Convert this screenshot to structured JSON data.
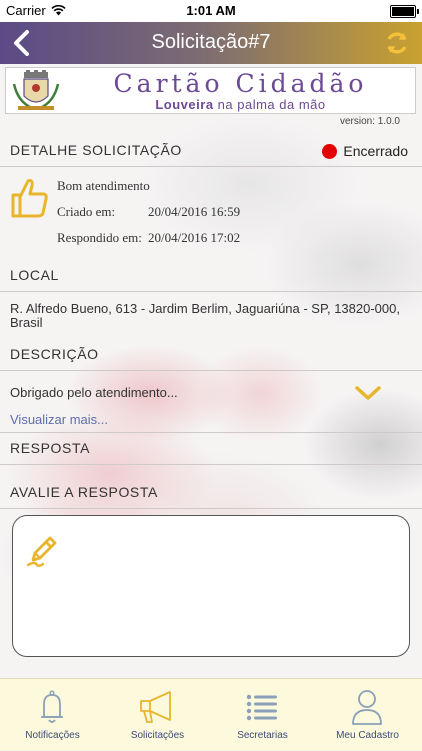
{
  "status_bar": {
    "carrier": "Carrier",
    "time": "1:01 AM",
    "battery_level": 1.0
  },
  "nav": {
    "title": "Solicitação#7"
  },
  "banner": {
    "brand": "Cartão Cidadão",
    "tagline_strong": "Louveira",
    "tagline_rest": " na palma da mão",
    "brand_color": "#6c4a94"
  },
  "version": "version: 1.0.0",
  "detail": {
    "section": "DETALHE SOLICITAÇÃO",
    "status_label": "Encerrado",
    "status_color": "#e50000",
    "rating_text": "Bom atendimento",
    "created_label": "Criado em:",
    "created_value": "20/04/2016 16:59",
    "answered_label": "Respondido em:",
    "answered_value": "20/04/2016 17:02"
  },
  "location": {
    "section": "LOCAL",
    "address": "R. Alfredo Bueno, 613 - Jardim Berlim, Jaguariúna - SP, 13820-000, Brasil"
  },
  "description": {
    "section": "DESCRIÇÃO",
    "text": "Obrigado pelo atendimento...",
    "more_link": "Visualizar mais..."
  },
  "response": {
    "section": "RESPOSTA"
  },
  "evaluate": {
    "section": "AVALIE A RESPOSTA"
  },
  "tabs": [
    {
      "label": "Notificações",
      "icon": "bell-icon"
    },
    {
      "label": "Solicitações",
      "icon": "megaphone-icon",
      "active": true
    },
    {
      "label": "Secretarias",
      "icon": "list-icon"
    },
    {
      "label": "Meu Cadastro",
      "icon": "user-icon"
    }
  ],
  "colors": {
    "accent": "#e8b62c",
    "tab_bar": "#fcf9dc",
    "tab_icon": "#8aa0b8"
  }
}
